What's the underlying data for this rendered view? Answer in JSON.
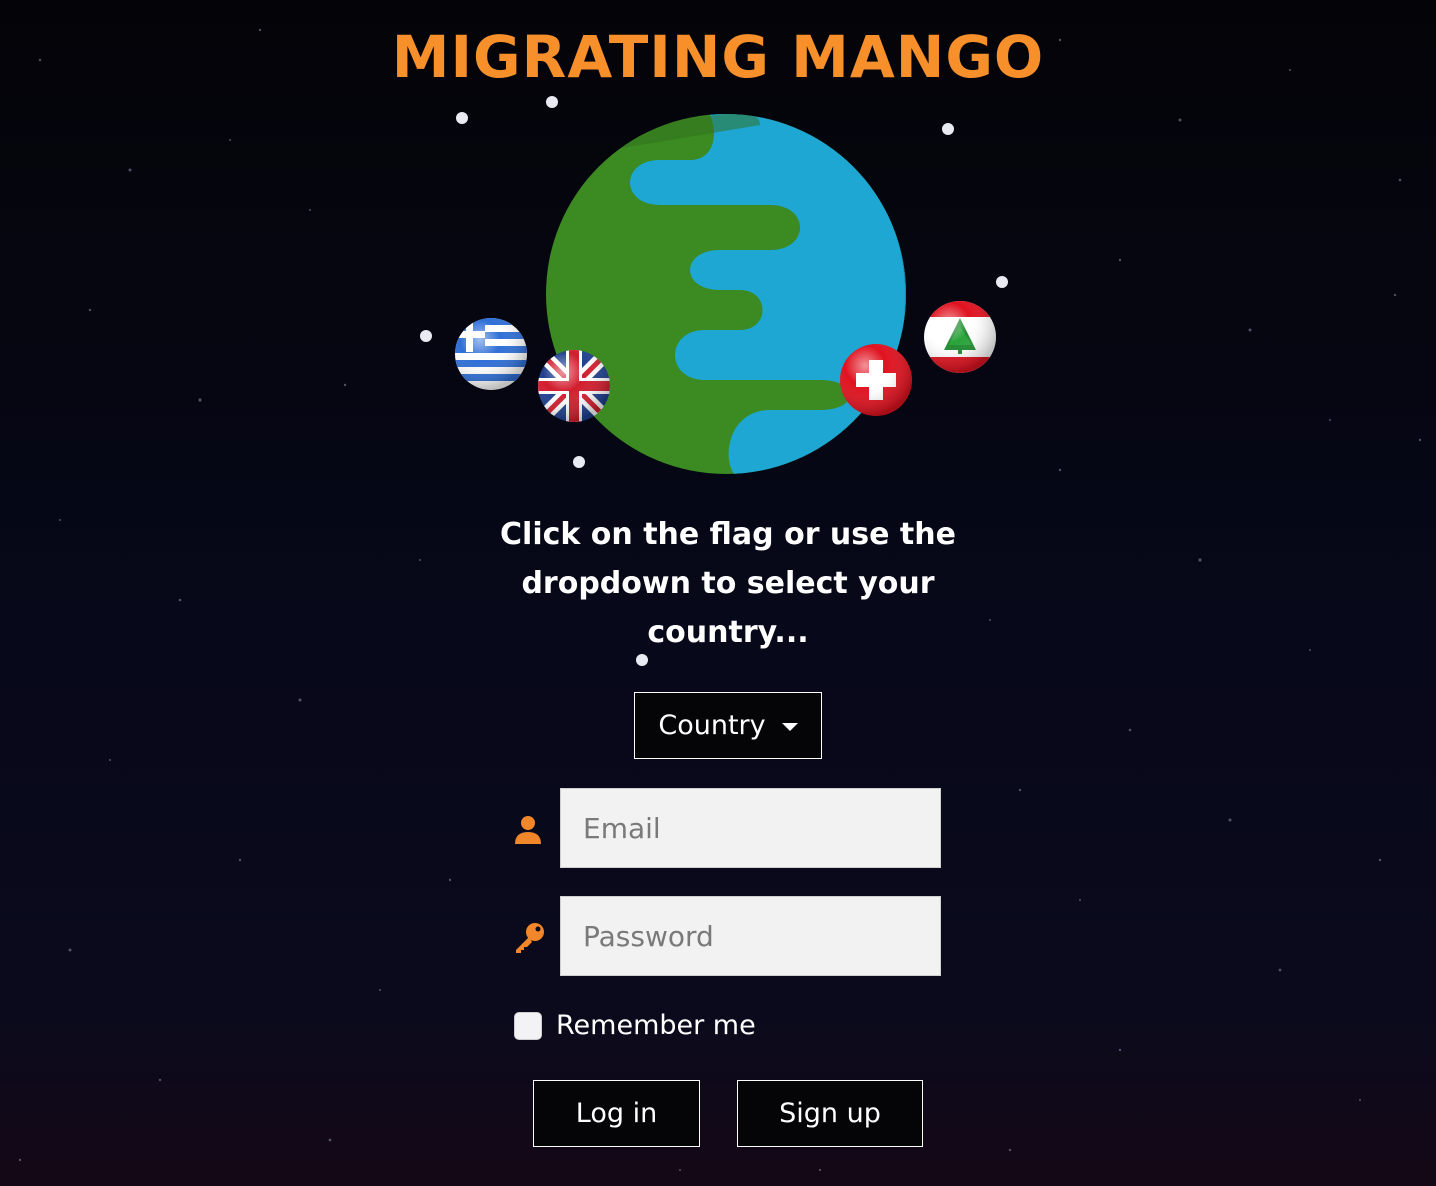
{
  "app": {
    "title": "MIGRATING MANGO",
    "brand_color": "#f7902a"
  },
  "instructions": "Click on the flag or use the dropdown to select your country...",
  "country_dropdown": {
    "label": "Country"
  },
  "flags": [
    {
      "name": "greece"
    },
    {
      "name": "united-kingdom"
    },
    {
      "name": "switzerland"
    },
    {
      "name": "lebanon"
    }
  ],
  "login_form": {
    "email_placeholder": "Email",
    "password_placeholder": "Password",
    "email_icon": "user-icon",
    "password_icon": "key-icon",
    "remember_label": "Remember me",
    "login_label": "Log in",
    "signup_label": "Sign up"
  }
}
